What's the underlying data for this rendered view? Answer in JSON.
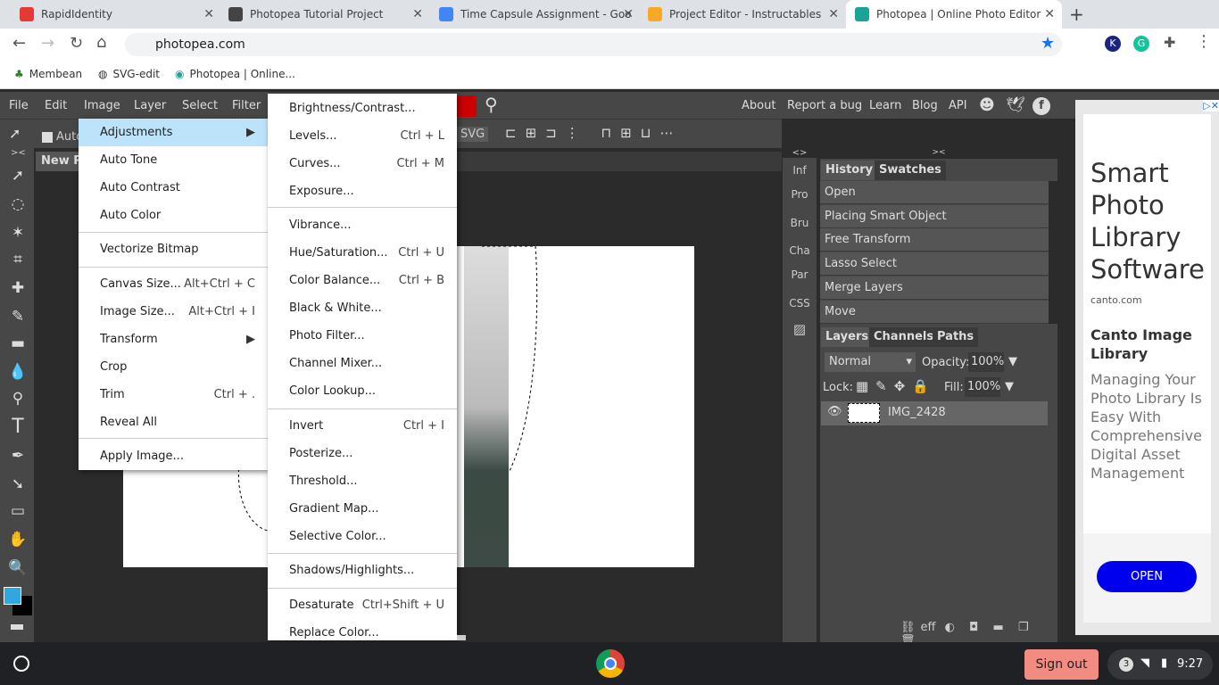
{
  "browser": {
    "tabs": [
      {
        "title": "RapidIdentity",
        "color": "#e53935"
      },
      {
        "title": "Photopea Tutorial Project",
        "color": "#444"
      },
      {
        "title": "Time Capsule Assignment - Goo",
        "color": "#4285f4"
      },
      {
        "title": "Project Editor - Instructables",
        "color": "#f9a825"
      },
      {
        "title": "Photopea | Online Photo Editor",
        "color": "#18a497"
      }
    ],
    "url": "photopea.com",
    "bookmarks": [
      "Membean",
      "SVG-edit",
      "Photopea | Online..."
    ]
  },
  "app": {
    "menu": [
      "File",
      "Edit",
      "Image",
      "Layer",
      "Select",
      "Filter"
    ],
    "links": [
      "About",
      "Report a bug",
      "Learn",
      "Blog",
      "API"
    ],
    "auto_label": "Auto",
    "svg_label": "SVG",
    "doc_tab": "New Pr",
    "side_tabs": [
      "Inf",
      "Pro",
      "Bru",
      "Cha",
      "Par",
      "CSS"
    ],
    "history_tabs": [
      "History",
      "Swatches"
    ],
    "history": [
      "Open",
      "Placing Smart Object",
      "Free Transform",
      "Lasso Select",
      "Merge Layers",
      "Move"
    ],
    "layers_tabs": [
      "Layers",
      "Channels",
      "Paths"
    ],
    "blend_mode": "Normal",
    "opacity_label": "Opacity:",
    "opacity": "100%",
    "lock_label": "Lock:",
    "fill_label": "Fill:",
    "fill": "100%",
    "layer_name": "IMG_2428",
    "eff_label": "eff",
    "fg_color": "#2fa8e0",
    "bg_color": "#000000"
  },
  "image_menu": [
    {
      "label": "Adjustments",
      "arrow": true
    },
    {
      "label": "Auto Tone"
    },
    {
      "label": "Auto Contrast"
    },
    {
      "label": "Auto Color"
    },
    {
      "label": "Vectorize Bitmap"
    },
    {
      "label": "Canvas Size...",
      "sc": "Alt+Ctrl + C"
    },
    {
      "label": "Image Size...",
      "sc": "Alt+Ctrl + I"
    },
    {
      "label": "Transform",
      "arrow": true
    },
    {
      "label": "Crop"
    },
    {
      "label": "Trim",
      "sc": "Ctrl + ."
    },
    {
      "label": "Reveal All"
    },
    {
      "label": "Apply Image..."
    }
  ],
  "adjust_menu": [
    {
      "label": "Brightness/Contrast..."
    },
    {
      "label": "Levels...",
      "sc": "Ctrl + L"
    },
    {
      "label": "Curves...",
      "sc": "Ctrl + M"
    },
    {
      "label": "Exposure..."
    },
    {
      "label": "Vibrance..."
    },
    {
      "label": "Hue/Saturation...",
      "sc": "Ctrl + U"
    },
    {
      "label": "Color Balance...",
      "sc": "Ctrl + B"
    },
    {
      "label": "Black & White..."
    },
    {
      "label": "Photo Filter..."
    },
    {
      "label": "Channel Mixer..."
    },
    {
      "label": "Color Lookup..."
    },
    {
      "label": "Invert",
      "sc": "Ctrl + I"
    },
    {
      "label": "Posterize..."
    },
    {
      "label": "Threshold..."
    },
    {
      "label": "Gradient Map..."
    },
    {
      "label": "Selective Color..."
    },
    {
      "label": "Shadows/Highlights..."
    },
    {
      "label": "Desaturate",
      "sc": "Ctrl+Shift + U"
    },
    {
      "label": "Replace Color..."
    }
  ],
  "ad": {
    "title": "Smart Photo Library Software",
    "domain": "canto.com",
    "subtitle": "Canto Image Library",
    "body": "Managing Your Photo Library Is Easy With Comprehensive Digital Asset Management",
    "button": "OPEN"
  },
  "taskbar": {
    "signout": "Sign out",
    "notif": "3",
    "time": "9:27"
  }
}
